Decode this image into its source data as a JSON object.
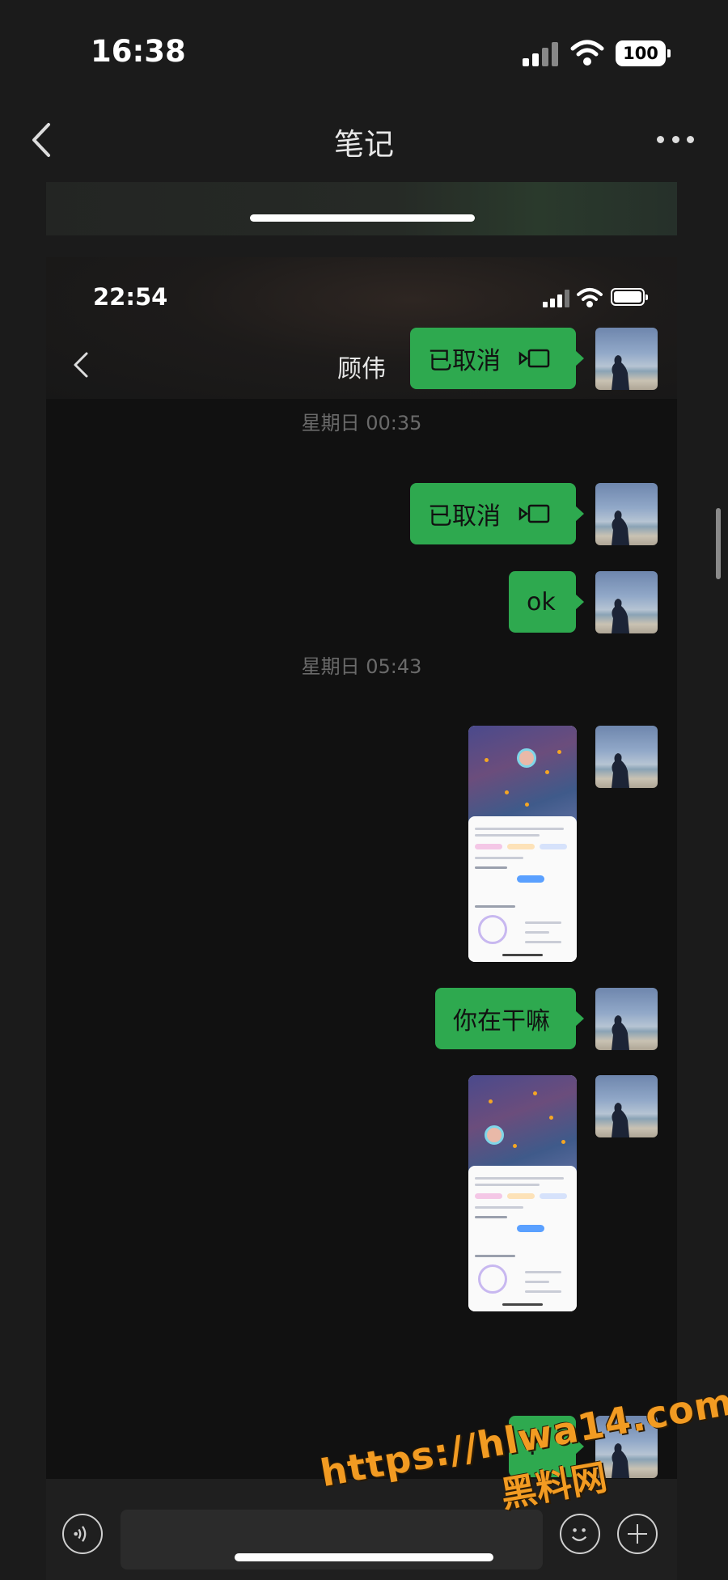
{
  "outer": {
    "time": "16:38",
    "battery": "100",
    "title": "笔记"
  },
  "chat": {
    "time": "22:54",
    "contact": "顾伟",
    "messages": [
      {
        "type": "text",
        "text": "已取消"
      },
      {
        "type": "time",
        "text": "星期日 00:35"
      },
      {
        "type": "text",
        "text": "已取消"
      },
      {
        "type": "text",
        "text": "ok"
      },
      {
        "type": "time",
        "text": "星期日 05:43"
      },
      {
        "type": "image"
      },
      {
        "type": "text",
        "text": "你在干嘛"
      },
      {
        "type": "image"
      },
      {
        "type": "text",
        "text": "?"
      }
    ]
  },
  "watermark": {
    "url": "https://hlwa14.com",
    "site": "黑料网"
  },
  "colors": {
    "bubble": "#2ea94f",
    "background": "#111111",
    "watermark": "#f29b22"
  },
  "icons": [
    "chevron-left-icon",
    "more-icon",
    "video-call-icon",
    "voice-icon",
    "emoji-icon",
    "plus-icon",
    "signal-icon",
    "wifi-icon",
    "battery-icon"
  ]
}
